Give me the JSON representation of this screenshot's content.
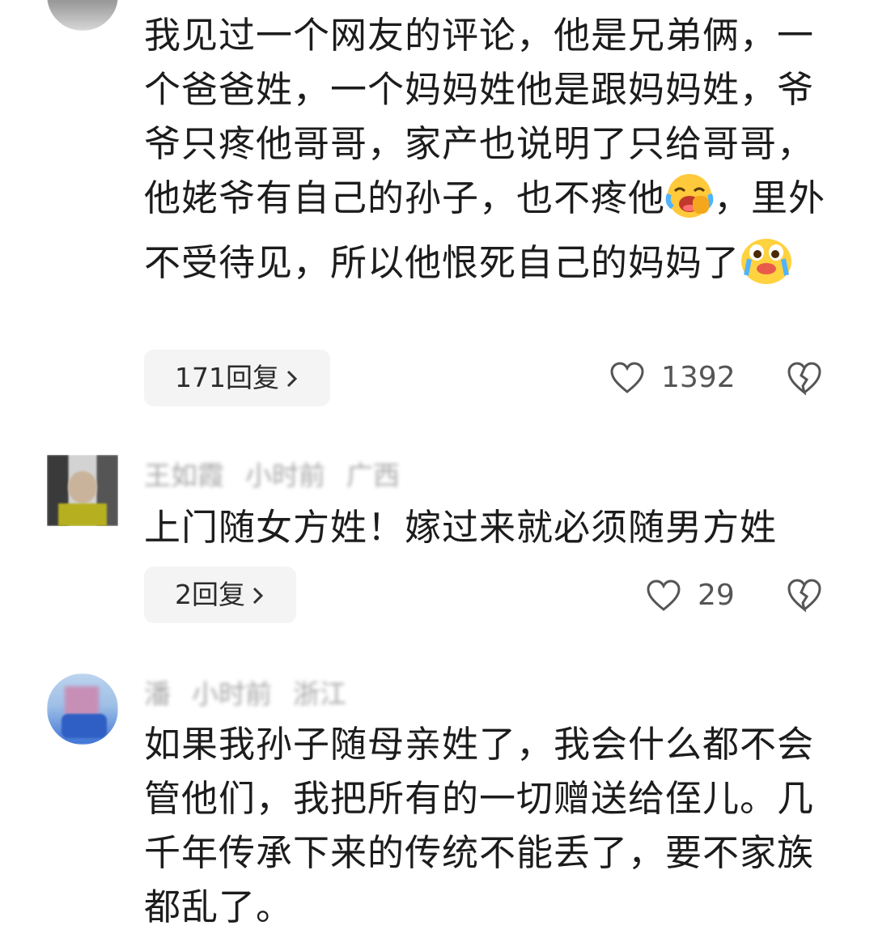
{
  "comments": [
    {
      "text_a": "我见过一个网友的评论，他是兄弟俩，一个爸爸姓，一个妈妈姓他是跟妈妈姓，爷爷只疼他哥哥，家产也说明了只给哥哥，他姥爷有自己的孙子，也不疼他",
      "text_b": "，里外不受待见，所以他恨死自己的妈妈了",
      "emoji_a": "laugh-cry-emoji",
      "emoji_b": "crying-emoji",
      "reply_label": "171回复",
      "likes": "1392"
    },
    {
      "author": "王如霞",
      "time": "小时前",
      "location": "广西",
      "text": "上门随女方姓！嫁过来就必须随男方姓",
      "reply_label": "2回复",
      "likes": "29"
    },
    {
      "author": "潘",
      "time": "小时前",
      "location": "浙江",
      "text": "如果我孙子随母亲姓了，我会什么都不会管他们，我把所有的一切赠送给侄儿。几千年传承下来的传统不能丢了，要不家族都乱了。"
    }
  ],
  "icons": {
    "like": "heart-outline-icon",
    "dislike": "broken-heart-icon",
    "chevron": "chevron-right-icon"
  },
  "colors": {
    "reply_bg": "#f4f4f4",
    "text": "#1c1c1c",
    "meta": "#8a8a8a"
  }
}
